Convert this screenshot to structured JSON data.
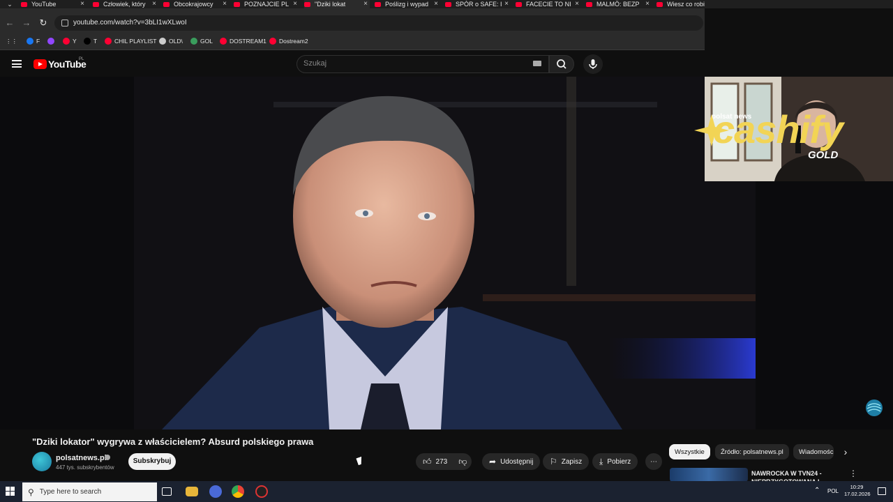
{
  "browser": {
    "tabs": [
      {
        "label": "YouTube",
        "active": false
      },
      {
        "label": "Człowiek, który",
        "active": false
      },
      {
        "label": "Obcokrajowcy",
        "active": false
      },
      {
        "label": "POZNAJCIE PL",
        "active": false
      },
      {
        "label": "\"Dziki lokat",
        "active": true
      },
      {
        "label": "Poślizg i wypad",
        "active": false
      },
      {
        "label": "SPÓR o SAFE: I",
        "active": false
      },
      {
        "label": "FACECIE TO NI",
        "active": false
      },
      {
        "label": "MALMÖ: BEZP",
        "active": false
      },
      {
        "label": "Wiesz co robi",
        "active": false
      }
    ],
    "url": "youtube.com/watch?v=3bLI1wXLwoI",
    "bookmarks": [
      {
        "label": "F",
        "color": "#1877f2"
      },
      {
        "label": "",
        "color": "#9146ff"
      },
      {
        "label": "Y",
        "color": "#ff0033"
      },
      {
        "label": "T",
        "color": "#000000"
      },
      {
        "label": "CHIL PLAYLIST",
        "color": "#ff0033"
      },
      {
        "label": "OLD\\",
        "color": "#cccccc"
      },
      {
        "label": "GOL",
        "color": "#3a9d5d"
      },
      {
        "label": "DOSTREAM1",
        "color": "#ff0033"
      },
      {
        "label": "Dostream2",
        "color": "#ff0033"
      }
    ]
  },
  "youtube": {
    "logo_text": "YouTube",
    "region": "PL",
    "search_placeholder": "Szukaj"
  },
  "overlay": {
    "brand": "cashify",
    "brand_sub": "GOLD",
    "mini_logo": "polsat news"
  },
  "video": {
    "title": "\"Dziki lokator\" wygrywa z właścicielem? Absurd polskiego prawa",
    "channel": "polsatnews.pl",
    "subscribers": "447 tys. subskrybentów",
    "subscribe_label": "Subskrybuj",
    "likes": "273",
    "share_label": "Udostępnij",
    "save_label": "Zapisz",
    "download_label": "Pobierz"
  },
  "sidebar": {
    "chips": [
      "Wszystkie",
      "Źródło: polsatnews.pl",
      "Wiadomości"
    ],
    "recommendation_title": "NAWROCKA W TVN24 - NIEPRZYGOTOWANA I"
  },
  "taskbar": {
    "search_placeholder": "Type here to search",
    "language": "POL",
    "time": "10:29",
    "date": "17.02.2026"
  }
}
